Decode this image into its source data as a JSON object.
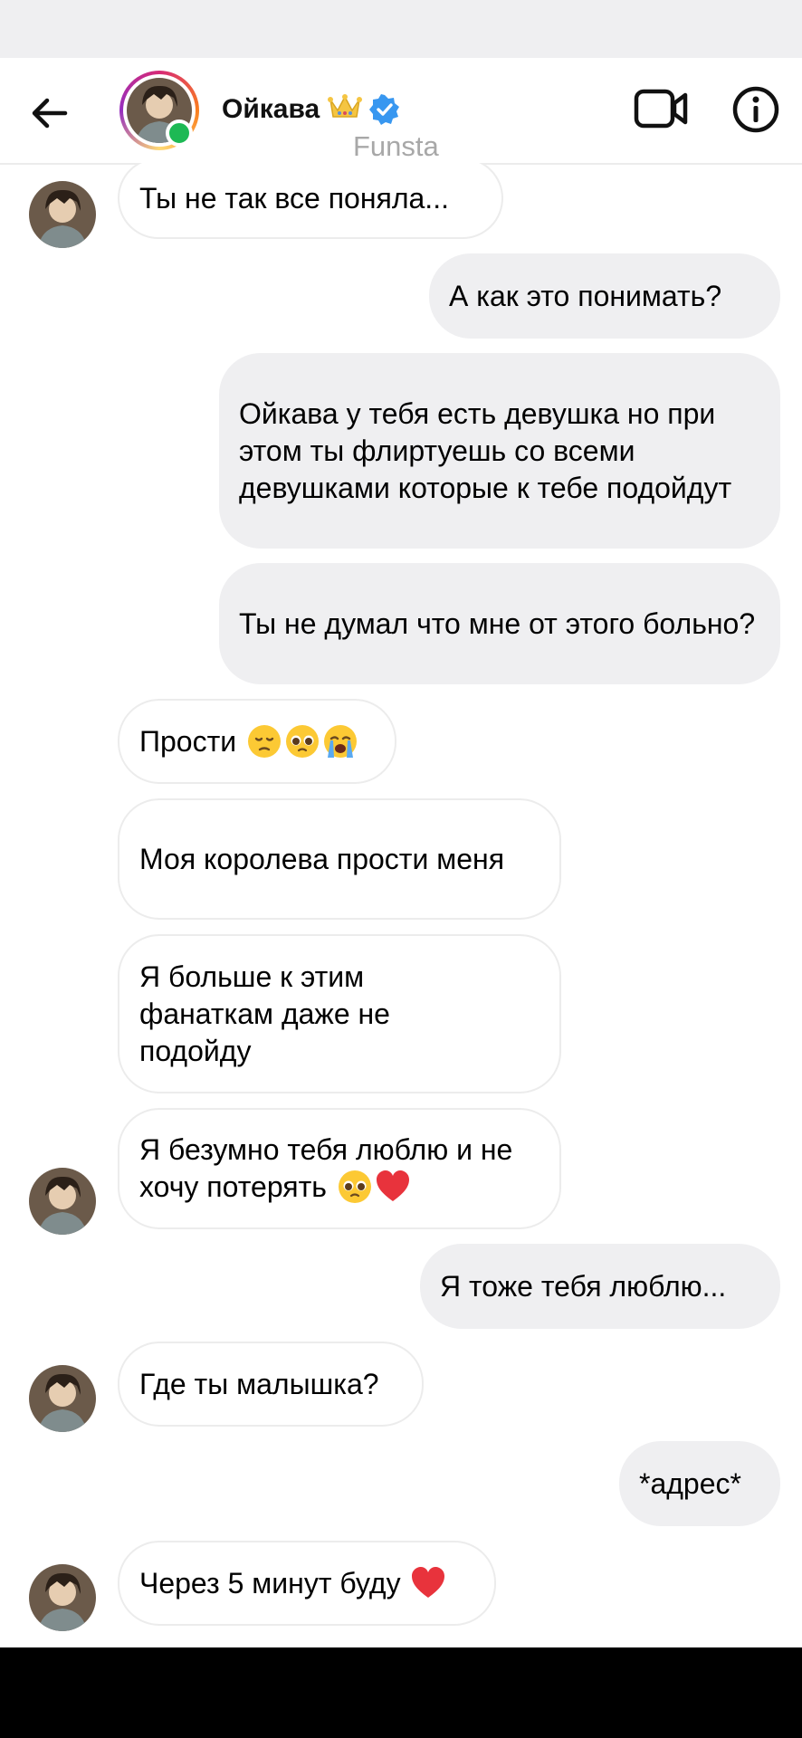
{
  "header": {
    "contact_name": "Ойкава",
    "subtitle": "Funsta"
  },
  "messages": [
    {
      "side": "in",
      "text": "Ты не так все поняла..."
    },
    {
      "side": "out",
      "text": "А как это понимать?"
    },
    {
      "side": "out",
      "text": "Ойкава у тебя есть девушка но при этом ты флиртуешь со всеми девушками которые к тебе подойдут"
    },
    {
      "side": "out",
      "text": "Ты не думал что мне от этого больно?"
    },
    {
      "side": "in",
      "text": "Прости",
      "emojis": [
        "pensive-face",
        "pleading-face",
        "crying-face"
      ]
    },
    {
      "side": "in",
      "text": "Моя королева прости меня"
    },
    {
      "side": "in",
      "text": "Я больше к этим фанаткам даже не подойду"
    },
    {
      "side": "in",
      "text": "Я безумно тебя люблю и не хочу потерять",
      "emojis": [
        "pleading-face",
        "red-heart"
      ]
    },
    {
      "side": "out",
      "text": "Я тоже тебя люблю..."
    },
    {
      "side": "in",
      "text": "Где ты малышка?"
    },
    {
      "side": "out",
      "text": "*адрес*"
    },
    {
      "side": "in",
      "text": "Через 5 минут буду",
      "emojis": [
        "red-heart"
      ]
    }
  ],
  "icons": {
    "back": "arrow-left-icon",
    "crown": "crown-icon",
    "verified": "verified-badge-icon",
    "video": "video-camera-icon",
    "info": "info-icon"
  },
  "colors": {
    "outgoing_bubble": "#efeff1",
    "incoming_border": "#ececec",
    "verified": "#3897f0",
    "online": "#1db954",
    "subtitle": "#a8a8a8"
  }
}
